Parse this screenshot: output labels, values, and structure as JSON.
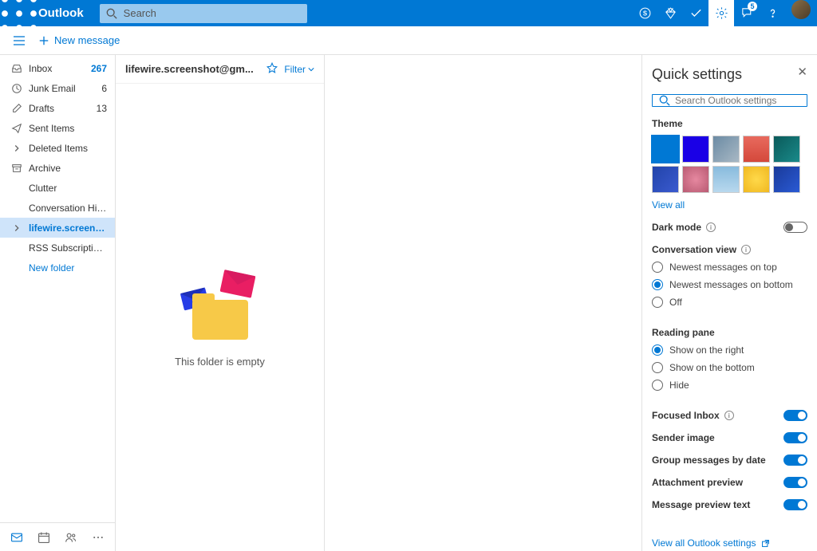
{
  "header": {
    "app_name": "Outlook",
    "search_placeholder": "Search",
    "chat_badge": "5"
  },
  "subheader": {
    "new_message": "New message"
  },
  "folders": [
    {
      "icon": "inbox",
      "label": "Inbox",
      "count": "267",
      "countClass": ""
    },
    {
      "icon": "clock",
      "label": "Junk Email",
      "count": "6",
      "countClass": "black"
    },
    {
      "icon": "draft",
      "label": "Drafts",
      "count": "13",
      "countClass": "black"
    },
    {
      "icon": "send",
      "label": "Sent Items",
      "count": "",
      "countClass": ""
    },
    {
      "icon": "chevron",
      "label": "Deleted Items",
      "count": "",
      "countClass": ""
    },
    {
      "icon": "archive",
      "label": "Archive",
      "count": "",
      "countClass": ""
    },
    {
      "icon": "none",
      "label": "Clutter",
      "count": "",
      "countClass": ""
    },
    {
      "icon": "none",
      "label": "Conversation Hist...",
      "count": "",
      "countClass": ""
    },
    {
      "icon": "chevron",
      "label": "lifewire.screensho...",
      "count": "",
      "countClass": "",
      "selected": true
    },
    {
      "icon": "none",
      "label": "RSS Subscriptions",
      "count": "",
      "countClass": ""
    },
    {
      "icon": "none",
      "label": "New folder",
      "count": "",
      "countClass": "",
      "newFolder": true
    }
  ],
  "messages": {
    "folder_title": "lifewire.screenshot@gm...",
    "filter_label": "Filter",
    "empty_text": "This folder is empty"
  },
  "settings": {
    "title": "Quick settings",
    "search_placeholder": "Search Outlook settings",
    "theme_label": "Theme",
    "view_all": "View all",
    "dark_mode": "Dark mode",
    "conversation_view": "Conversation view",
    "conv_options": [
      {
        "label": "Newest messages on top",
        "checked": false
      },
      {
        "label": "Newest messages on bottom",
        "checked": true
      },
      {
        "label": "Off",
        "checked": false
      }
    ],
    "reading_pane": "Reading pane",
    "pane_options": [
      {
        "label": "Show on the right",
        "checked": true
      },
      {
        "label": "Show on the bottom",
        "checked": false
      },
      {
        "label": "Hide",
        "checked": false
      }
    ],
    "toggles": [
      {
        "label": "Focused Inbox",
        "on": true,
        "info": true
      },
      {
        "label": "Sender image",
        "on": true,
        "info": false
      },
      {
        "label": "Group messages by date",
        "on": true,
        "info": false
      },
      {
        "label": "Attachment preview",
        "on": true,
        "info": false
      },
      {
        "label": "Message preview text",
        "on": true,
        "info": false
      }
    ],
    "view_all_settings": "View all Outlook settings",
    "themes": [
      "#0078d4",
      "#1a00e6",
      "linear-gradient(135deg,#6b8ba4,#a8b8c4)",
      "linear-gradient(180deg,#e86a5e,#d4483b)",
      "linear-gradient(135deg,#0a5a5a,#1a8a8a)",
      "linear-gradient(135deg,#2244aa,#3a5acf)",
      "radial-gradient(circle,#e688a0,#b85a72)",
      "linear-gradient(180deg,#88bbdd,#b8d8ee)",
      "radial-gradient(circle,#ffd94a,#f0b820)",
      "linear-gradient(135deg,#1a3a9a,#2a5ad4)"
    ]
  }
}
